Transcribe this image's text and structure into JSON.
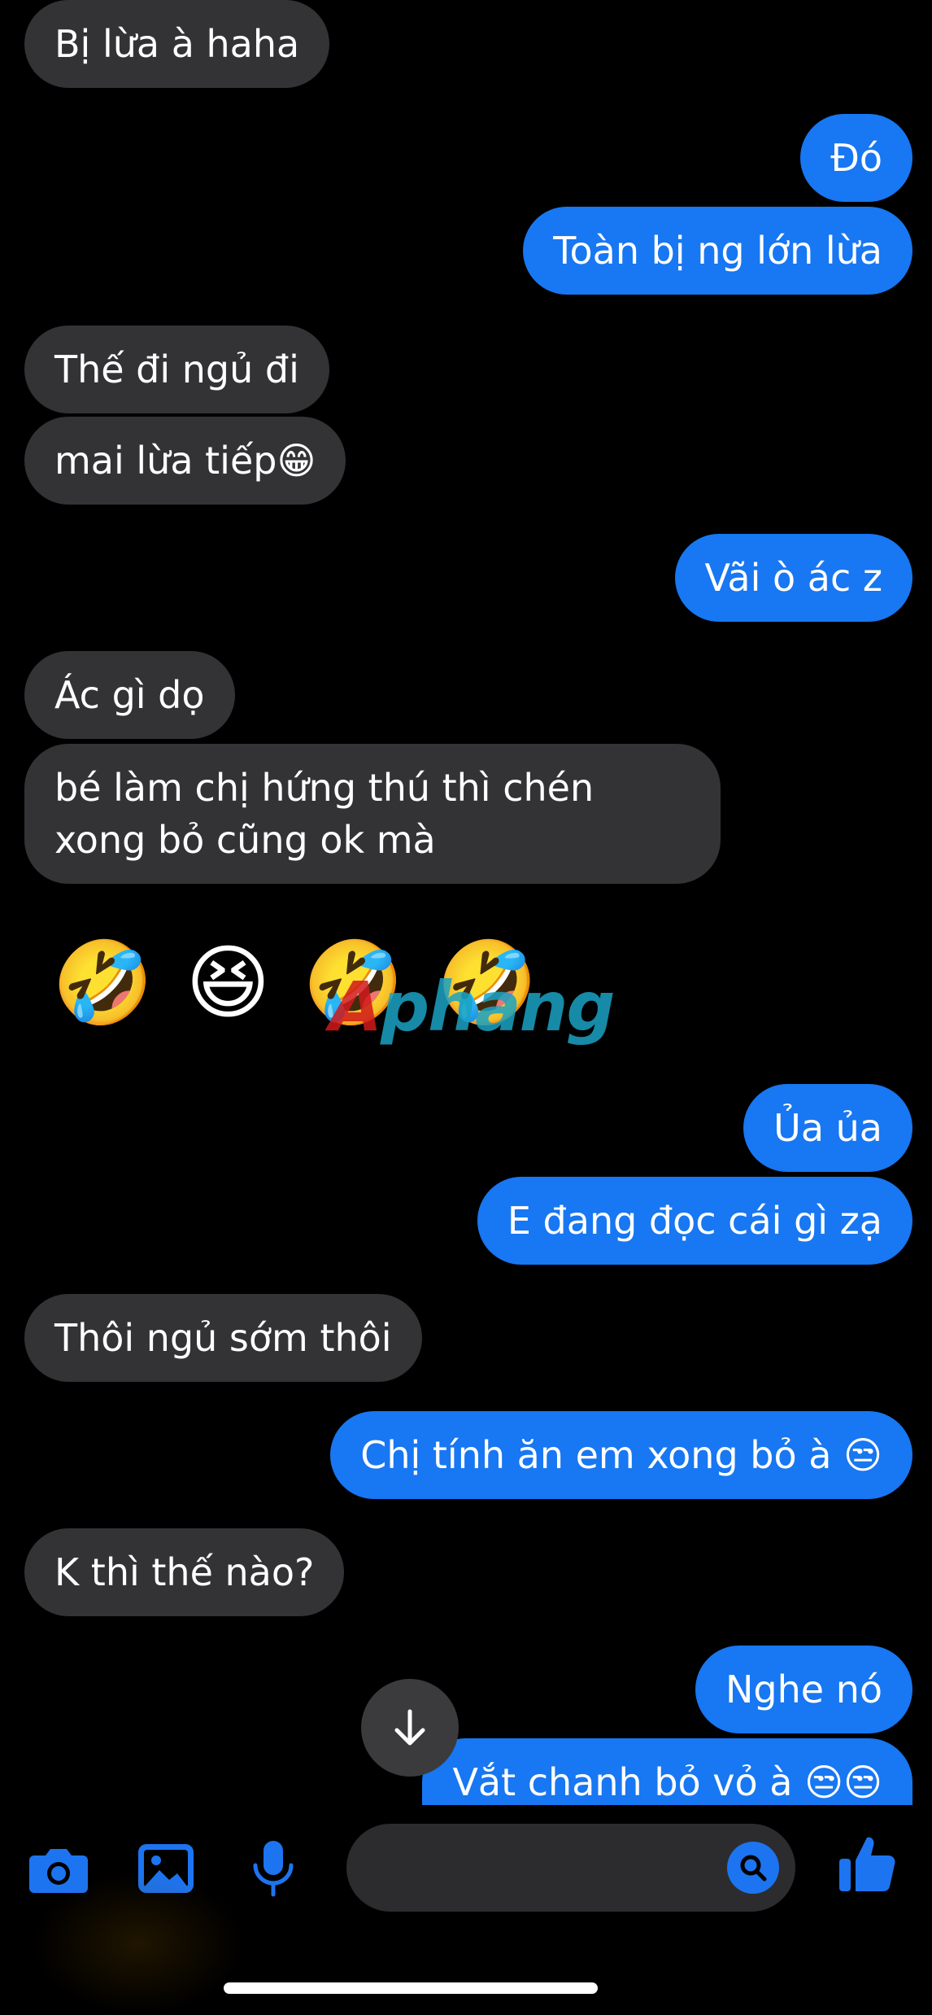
{
  "conversation": {
    "messages": [
      {
        "side": "incoming",
        "text": "Bị lừa à haha"
      },
      {
        "side": "outgoing",
        "text": "Đó"
      },
      {
        "side": "outgoing",
        "text": "Toàn bị ng lớn lừa"
      },
      {
        "side": "incoming",
        "text": "Thế đi ngủ đi"
      },
      {
        "side": "incoming",
        "text": "mai lừa tiếp😁"
      },
      {
        "side": "outgoing",
        "text": "Vãi ò ác z"
      },
      {
        "side": "incoming",
        "text": "Ác gì dọ"
      },
      {
        "side": "incoming",
        "text": "bé làm chị hứng thú thì chén xong bỏ cũng ok mà"
      },
      {
        "side": "incoming",
        "text": "🤣 😆 🤣 🤣",
        "emoji_only": true
      },
      {
        "side": "outgoing",
        "text": "Ủa ủa"
      },
      {
        "side": "outgoing",
        "text": "E đang đọc cái gì zạ"
      },
      {
        "side": "incoming",
        "text": "Thôi ngủ sớm thôi"
      },
      {
        "side": "outgoing",
        "text": "Chị tính ăn em xong bỏ à 😒"
      },
      {
        "side": "incoming",
        "text": "K thì thế nào?"
      },
      {
        "side": "outgoing",
        "text": "Nghe nó"
      },
      {
        "side": "outgoing",
        "text": "Vắt chanh bỏ vỏ à 😒😒"
      }
    ]
  },
  "watermark": {
    "first_letter": "A",
    "rest": "phang"
  },
  "composer": {
    "message_placeholder": "",
    "icons": [
      "camera-icon",
      "image-icon",
      "microphone-icon",
      "search-icon",
      "thumbs-up-icon"
    ]
  },
  "colors": {
    "background": "#000000",
    "incoming_bubble": "#333335",
    "outgoing_bubble": "#1877f2",
    "accent": "#1d74f0"
  }
}
